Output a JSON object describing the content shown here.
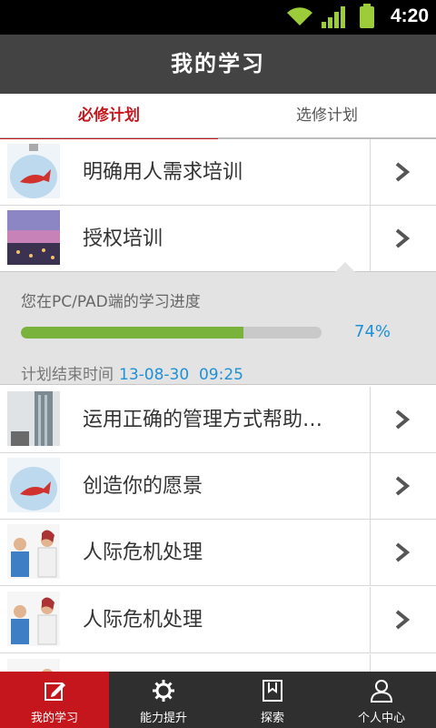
{
  "status_bar": {
    "time": "4:20"
  },
  "header": {
    "title": "我的学习"
  },
  "tabs": [
    {
      "label": "必修计划",
      "active": true
    },
    {
      "label": "选修计划",
      "active": false
    }
  ],
  "list": {
    "items": [
      {
        "label": "明确用人需求培训",
        "thumb": "fish-in-bulb"
      },
      {
        "label": "授权培训",
        "thumb": "city-sunset"
      },
      {
        "label": "运用正确的管理方式帮助…",
        "thumb": "skyscraper"
      },
      {
        "label": "创造你的愿景",
        "thumb": "fish-in-bulb"
      },
      {
        "label": "人际危机处理",
        "thumb": "arguing-couple"
      },
      {
        "label": "人际危机处理",
        "thumb": "arguing-couple"
      }
    ]
  },
  "progress": {
    "heading": "您在PC/PAD端的学习进度",
    "percent_label": "74%",
    "percent_value": 0.74,
    "end_label": "计划结束时间",
    "end_datetime": "13-08-30  09:25"
  },
  "bottom_nav": [
    {
      "label": "我的学习",
      "icon": "edit-icon",
      "active": true
    },
    {
      "label": "能力提升",
      "icon": "gear-icon",
      "active": false
    },
    {
      "label": "探索",
      "icon": "bookmark-icon",
      "active": false
    },
    {
      "label": "个人中心",
      "icon": "person-icon",
      "active": false
    }
  ],
  "colors": {
    "accent": "#c4161c",
    "progress": "#7ab33b",
    "link": "#1e90d6",
    "titlebar": "#434343"
  }
}
